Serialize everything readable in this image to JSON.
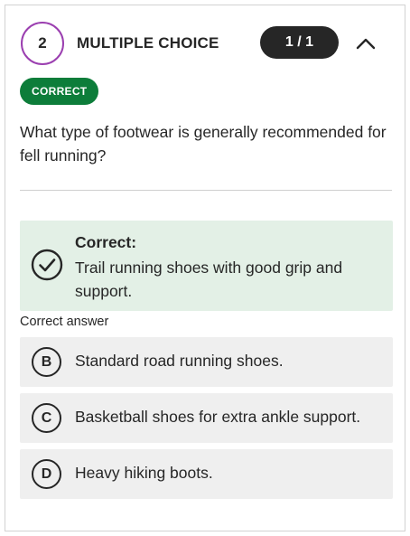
{
  "question": {
    "number": "2",
    "type_label": "MULTIPLE CHOICE",
    "score": "1 / 1",
    "status": "CORRECT",
    "text": "What type of footwear is generally recommended for fell running?"
  },
  "icons": {
    "collapse": "chevron-up-icon",
    "feedback": "check-circle-icon"
  },
  "feedback": {
    "title": "Correct:",
    "answer_text": "Trail running shoes with good grip and support."
  },
  "correct_answer_label": "Correct answer",
  "options": [
    {
      "letter": "B",
      "text": "Standard road running shoes."
    },
    {
      "letter": "C",
      "text": "Basketball shoes for extra ankle support."
    },
    {
      "letter": "D",
      "text": "Heavy hiking boots."
    }
  ],
  "colors": {
    "badge_green": "#0d7d3a",
    "feedback_bg": "#e3f0e6",
    "number_ring": "#9b3fb0",
    "pill_dark": "#262626",
    "option_bg": "#efefef"
  }
}
